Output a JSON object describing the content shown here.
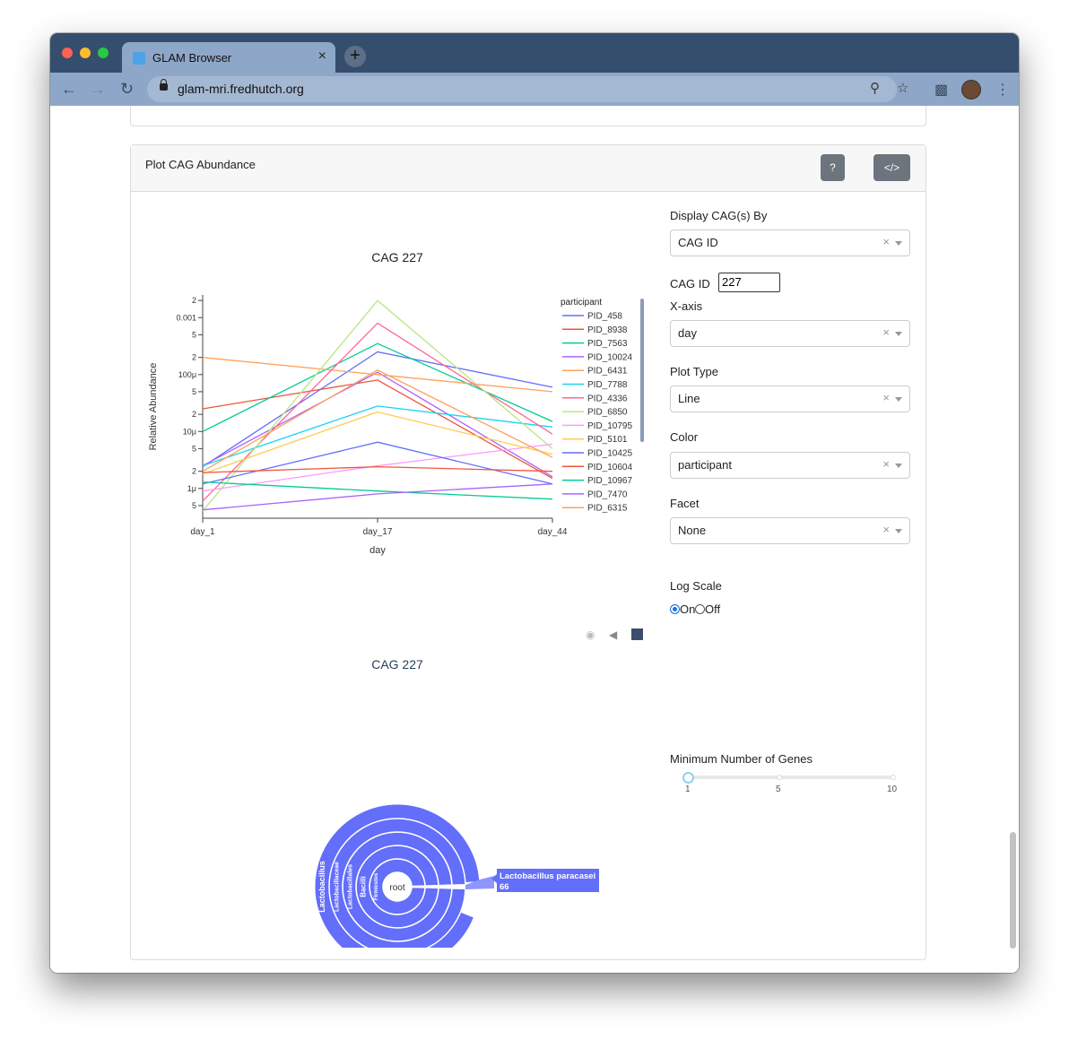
{
  "browser": {
    "tab_title": "GLAM Browser",
    "url": "glam-mri.fredhutch.org",
    "close_glyph": "×",
    "newtab_glyph": "+"
  },
  "card": {
    "title": "Plot CAG Abundance",
    "help_label": "?",
    "code_label": "</>"
  },
  "controls": {
    "display_by_label": "Display CAG(s) By",
    "display_by_value": "CAG ID",
    "cag_id_label": "CAG ID",
    "cag_id_value": "227",
    "xaxis_label": "X-axis",
    "xaxis_value": "day",
    "plot_type_label": "Plot Type",
    "plot_type_value": "Line",
    "color_label": "Color",
    "color_value": "participant",
    "facet_label": "Facet",
    "facet_value": "None",
    "log_scale_label": "Log Scale",
    "log_on_label": "On",
    "log_off_label": "Off",
    "log_scale_selected": "On",
    "min_genes_label": "Minimum Number of Genes",
    "min_genes_ticks": [
      "1",
      "5",
      "10"
    ],
    "min_genes_value": 1,
    "clear_glyph": "×"
  },
  "chart_data": [
    {
      "type": "line",
      "title": "CAG 227",
      "xlabel": "day",
      "ylabel": "Relative Abundance",
      "x": [
        "day_1",
        "day_17",
        "day_44"
      ],
      "yscale": "log",
      "ylim": [
        3e-07,
        0.0025
      ],
      "ytick_labels": [
        "5",
        "1μ",
        "2",
        "5",
        "10μ",
        "2",
        "5",
        "100μ",
        "2",
        "5",
        "0.001",
        "2"
      ],
      "legend_title": "participant",
      "legend_position": "right",
      "series": [
        {
          "name": "PID_458",
          "color": "#636efa",
          "values": [
            2.4e-06,
            0.00025,
            6e-05
          ]
        },
        {
          "name": "PID_8938",
          "color": "#ef553b",
          "values": [
            2.5e-05,
            8e-05,
            1.5e-06
          ]
        },
        {
          "name": "PID_7563",
          "color": "#00cc96",
          "values": [
            1e-05,
            0.00035,
            1.5e-05
          ]
        },
        {
          "name": "PID_10024",
          "color": "#ab63fa",
          "values": [
            2.5e-06,
            0.00011,
            1.6e-06
          ]
        },
        {
          "name": "PID_6431",
          "color": "#ffa15a",
          "values": [
            0.0002,
            0.0001,
            5e-05
          ]
        },
        {
          "name": "PID_7788",
          "color": "#19d3f3",
          "values": [
            2.5e-06,
            2.8e-05,
            1.2e-05
          ]
        },
        {
          "name": "PID_4336",
          "color": "#ff6692",
          "values": [
            6e-07,
            0.0008,
            9e-06
          ]
        },
        {
          "name": "PID_6850",
          "color": "#b6e880",
          "values": [
            4e-07,
            0.002,
            5e-06
          ]
        },
        {
          "name": "PID_10795",
          "color": "#ff97ff",
          "values": [
            9e-07,
            2.5e-06,
            6e-06
          ]
        },
        {
          "name": "PID_5101",
          "color": "#fecb52",
          "values": [
            1.8e-06,
            2.2e-05,
            4e-06
          ]
        },
        {
          "name": "PID_10425",
          "color": "#636efa",
          "values": [
            1.2e-06,
            6.5e-06,
            1.2e-06
          ]
        },
        {
          "name": "PID_10604",
          "color": "#ef553b",
          "values": [
            1.9e-06,
            2.4e-06,
            2e-06
          ]
        },
        {
          "name": "PID_10967",
          "color": "#00cc96",
          "values": [
            1.3e-06,
            9e-07,
            6.5e-07
          ]
        },
        {
          "name": "PID_7470",
          "color": "#ab63fa",
          "values": [
            4.2e-07,
            8e-07,
            1.2e-06
          ]
        },
        {
          "name": "PID_6315",
          "color": "#ffa15a",
          "values": [
            2e-06,
            0.00012,
            3.5e-06
          ]
        }
      ]
    },
    {
      "type": "sunburst",
      "title": "CAG 227",
      "center_label": "root",
      "ring_labels": [
        "Firmicutes",
        "Bacilli",
        "Lactobacillales",
        "Lactobacillaceae",
        "Lactobacillus"
      ],
      "hover_label": "Lactobacillus paracasei",
      "hover_value": "66",
      "color": "#636efa"
    }
  ]
}
